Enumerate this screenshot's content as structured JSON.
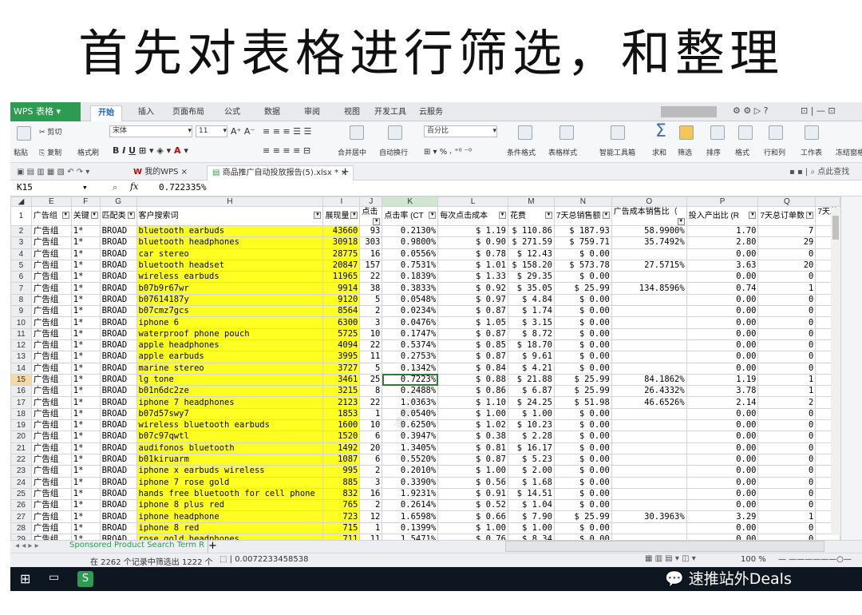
{
  "slide_title": "首先对表格进行筛选，和整理",
  "app": {
    "name": "WPS 表格",
    "menu": [
      "开始",
      "插入",
      "页面布局",
      "公式",
      "数据",
      "审阅",
      "视图",
      "开发工具",
      "云服务"
    ],
    "search_hint": "点此查找"
  },
  "ribbon": {
    "paste": "粘贴",
    "cut": "剪切",
    "copy": "复制",
    "format_painter": "格式刷",
    "font_name": "宋体",
    "font_size": "11",
    "merge_center": "合并居中",
    "wrap": "自动换行",
    "number_format": "百分比",
    "cond_format": "条件格式",
    "table_style": "表格样式",
    "smart_toolbox": "智能工具箱",
    "sum": "求和",
    "filter": "筛选",
    "sort": "排序",
    "format": "格式",
    "rowcol": "行和列",
    "sheet": "工作表",
    "freeze": "冻结窗格"
  },
  "doc_tabs": [
    "我的WPS",
    "商品推广自动投放报告(5).xlsx *"
  ],
  "formula_bar": {
    "cell_ref": "K15",
    "fx": "fx",
    "value": "0.722335%"
  },
  "columns": [
    "E",
    "F",
    "G",
    "H",
    "I",
    "J",
    "K",
    "L",
    "M",
    "N",
    "O",
    "P",
    "Q"
  ],
  "headers": [
    "广告组",
    "关键",
    "匹配类",
    "客户搜索词",
    "展现量",
    "点击",
    "点击率 (CT",
    "每次点击成本",
    "花费",
    "7天总销售额",
    "广告成本销售比（",
    "投入产出比 (R",
    "7天总订单数",
    "7天总"
  ],
  "rows": [
    {
      "n": "2",
      "e": "广告组",
      "f": "1*",
      "g": "BROAD",
      "h": "bluetooth earbuds",
      "i": "43660",
      "j": "93",
      "k": "0.2130%",
      "l": "$ 1.19",
      "m": "$ 110.86",
      "nn": "$ 187.93",
      "o": "58.9900%",
      "p": "1.70",
      "q": "7"
    },
    {
      "n": "3",
      "e": "广告组",
      "f": "1*",
      "g": "BROAD",
      "h": "bluetooth headphones",
      "i": "30918",
      "j": "303",
      "k": "0.9800%",
      "l": "$ 0.90",
      "m": "$ 271.59",
      "nn": "$ 759.71",
      "o": "35.7492%",
      "p": "2.80",
      "q": "29"
    },
    {
      "n": "4",
      "e": "广告组",
      "f": "1*",
      "g": "BROAD",
      "h": "car stereo",
      "i": "28775",
      "j": "16",
      "k": "0.0556%",
      "l": "$ 0.78",
      "m": "$ 12.43",
      "nn": "$ 0.00",
      "o": "",
      "p": "0.00",
      "q": "0"
    },
    {
      "n": "5",
      "e": "广告组",
      "f": "1*",
      "g": "BROAD",
      "h": "bluetooth headset",
      "i": "20847",
      "j": "157",
      "k": "0.7531%",
      "l": "$ 1.01",
      "m": "$ 158.20",
      "nn": "$ 573.78",
      "o": "27.5715%",
      "p": "3.63",
      "q": "20"
    },
    {
      "n": "6",
      "e": "广告组",
      "f": "1*",
      "g": "BROAD",
      "h": "wireless earbuds",
      "i": "11965",
      "j": "22",
      "k": "0.1839%",
      "l": "$ 1.33",
      "m": "$ 29.35",
      "nn": "$ 0.00",
      "o": "",
      "p": "0.00",
      "q": "0"
    },
    {
      "n": "7",
      "e": "广告组",
      "f": "1*",
      "g": "BROAD",
      "h": "b07b9r67wr",
      "i": "9914",
      "j": "38",
      "k": "0.3833%",
      "l": "$ 0.92",
      "m": "$ 35.05",
      "nn": "$ 25.99",
      "o": "134.8596%",
      "p": "0.74",
      "q": "1"
    },
    {
      "n": "8",
      "e": "广告组",
      "f": "1*",
      "g": "BROAD",
      "h": "b07614187y",
      "i": "9120",
      "j": "5",
      "k": "0.0548%",
      "l": "$ 0.97",
      "m": "$ 4.84",
      "nn": "$ 0.00",
      "o": "",
      "p": "0.00",
      "q": "0"
    },
    {
      "n": "9",
      "e": "广告组",
      "f": "1*",
      "g": "BROAD",
      "h": "b07cmz7gcs",
      "i": "8564",
      "j": "2",
      "k": "0.0234%",
      "l": "$ 0.87",
      "m": "$ 1.74",
      "nn": "$ 0.00",
      "o": "",
      "p": "0.00",
      "q": "0"
    },
    {
      "n": "10",
      "e": "广告组",
      "f": "1*",
      "g": "BROAD",
      "h": "iphone 6",
      "i": "6300",
      "j": "3",
      "k": "0.0476%",
      "l": "$ 1.05",
      "m": "$ 3.15",
      "nn": "$ 0.00",
      "o": "",
      "p": "0.00",
      "q": "0"
    },
    {
      "n": "11",
      "e": "广告组",
      "f": "1*",
      "g": "BROAD",
      "h": "waterproof phone pouch",
      "i": "5725",
      "j": "10",
      "k": "0.1747%",
      "l": "$ 0.87",
      "m": "$ 8.72",
      "nn": "$ 0.00",
      "o": "",
      "p": "0.00",
      "q": "0"
    },
    {
      "n": "12",
      "e": "广告组",
      "f": "1*",
      "g": "BROAD",
      "h": "apple headphones",
      "i": "4094",
      "j": "22",
      "k": "0.5374%",
      "l": "$ 0.85",
      "m": "$ 18.70",
      "nn": "$ 0.00",
      "o": "",
      "p": "0.00",
      "q": "0"
    },
    {
      "n": "13",
      "e": "广告组",
      "f": "1*",
      "g": "BROAD",
      "h": "apple earbuds",
      "i": "3995",
      "j": "11",
      "k": "0.2753%",
      "l": "$ 0.87",
      "m": "$ 9.61",
      "nn": "$ 0.00",
      "o": "",
      "p": "0.00",
      "q": "0"
    },
    {
      "n": "14",
      "e": "广告组",
      "f": "1*",
      "g": "BROAD",
      "h": "marine stereo",
      "i": "3727",
      "j": "5",
      "k": "0.1342%",
      "l": "$ 0.84",
      "m": "$ 4.21",
      "nn": "$ 0.00",
      "o": "",
      "p": "0.00",
      "q": "0"
    },
    {
      "n": "15",
      "e": "广告组",
      "f": "1*",
      "g": "BROAD",
      "h": "lg tone",
      "i": "3461",
      "j": "25",
      "k": "0.7223%",
      "l": "$ 0.88",
      "m": "$ 21.88",
      "nn": "$ 25.99",
      "o": "84.1862%",
      "p": "1.19",
      "q": "1"
    },
    {
      "n": "16",
      "e": "广告组",
      "f": "1*",
      "g": "BROAD",
      "h": "b01n6dc2ze",
      "i": "3215",
      "j": "8",
      "k": "0.2488%",
      "l": "$ 0.86",
      "m": "$ 6.87",
      "nn": "$ 25.99",
      "o": "26.4332%",
      "p": "3.78",
      "q": "1"
    },
    {
      "n": "17",
      "e": "广告组",
      "f": "1*",
      "g": "BROAD",
      "h": "iphone 7 headphones",
      "i": "2123",
      "j": "22",
      "k": "1.0363%",
      "l": "$ 1.10",
      "m": "$ 24.25",
      "nn": "$ 51.98",
      "o": "46.6526%",
      "p": "2.14",
      "q": "2"
    },
    {
      "n": "18",
      "e": "广告组",
      "f": "1*",
      "g": "BROAD",
      "h": "b07d57swy7",
      "i": "1853",
      "j": "1",
      "k": "0.0540%",
      "l": "$ 1.00",
      "m": "$ 1.00",
      "nn": "$ 0.00",
      "o": "",
      "p": "0.00",
      "q": "0"
    },
    {
      "n": "19",
      "e": "广告组",
      "f": "1*",
      "g": "BROAD",
      "h": "wireless bluetooth earbuds",
      "i": "1600",
      "j": "10",
      "k": "0.6250%",
      "l": "$ 1.02",
      "m": "$ 10.23",
      "nn": "$ 0.00",
      "o": "",
      "p": "0.00",
      "q": "0"
    },
    {
      "n": "20",
      "e": "广告组",
      "f": "1*",
      "g": "BROAD",
      "h": "b07c97qwtl",
      "i": "1520",
      "j": "6",
      "k": "0.3947%",
      "l": "$ 0.38",
      "m": "$ 2.28",
      "nn": "$ 0.00",
      "o": "",
      "p": "0.00",
      "q": "0"
    },
    {
      "n": "21",
      "e": "广告组",
      "f": "1*",
      "g": "BROAD",
      "h": "audifonos bluetooth",
      "i": "1492",
      "j": "20",
      "k": "1.3405%",
      "l": "$ 0.81",
      "m": "$ 16.17",
      "nn": "$ 0.00",
      "o": "",
      "p": "0.00",
      "q": "0"
    },
    {
      "n": "22",
      "e": "广告组",
      "f": "1*",
      "g": "BROAD",
      "h": "b01kiruarm",
      "i": "1087",
      "j": "6",
      "k": "0.5520%",
      "l": "$ 0.87",
      "m": "$ 5.23",
      "nn": "$ 0.00",
      "o": "",
      "p": "0.00",
      "q": "0"
    },
    {
      "n": "23",
      "e": "广告组",
      "f": "1*",
      "g": "BROAD",
      "h": "iphone x earbuds wireless",
      "i": "995",
      "j": "2",
      "k": "0.2010%",
      "l": "$ 1.00",
      "m": "$ 2.00",
      "nn": "$ 0.00",
      "o": "",
      "p": "0.00",
      "q": "0"
    },
    {
      "n": "24",
      "e": "广告组",
      "f": "1*",
      "g": "BROAD",
      "h": "iphone 7 rose gold",
      "i": "885",
      "j": "3",
      "k": "0.3390%",
      "l": "$ 0.56",
      "m": "$ 1.68",
      "nn": "$ 0.00",
      "o": "",
      "p": "0.00",
      "q": "0"
    },
    {
      "n": "25",
      "e": "广告组",
      "f": "1*",
      "g": "BROAD",
      "h": "hands free bluetooth for cell phone",
      "i": "832",
      "j": "16",
      "k": "1.9231%",
      "l": "$ 0.91",
      "m": "$ 14.51",
      "nn": "$ 0.00",
      "o": "",
      "p": "0.00",
      "q": "0"
    },
    {
      "n": "26",
      "e": "广告组",
      "f": "1*",
      "g": "BROAD",
      "h": "iphone 8 plus red",
      "i": "765",
      "j": "2",
      "k": "0.2614%",
      "l": "$ 0.52",
      "m": "$ 1.04",
      "nn": "$ 0.00",
      "o": "",
      "p": "0.00",
      "q": "0"
    },
    {
      "n": "27",
      "e": "广告组",
      "f": "1*",
      "g": "BROAD",
      "h": "iphone headphone",
      "i": "723",
      "j": "12",
      "k": "1.6598%",
      "l": "$ 0.66",
      "m": "$ 7.90",
      "nn": "$ 25.99",
      "o": "30.3963%",
      "p": "3.29",
      "q": "1"
    },
    {
      "n": "28",
      "e": "广告组",
      "f": "1*",
      "g": "BROAD",
      "h": "iphone 8 red",
      "i": "715",
      "j": "1",
      "k": "0.1399%",
      "l": "$ 1.00",
      "m": "$ 1.00",
      "nn": "$ 0.00",
      "o": "",
      "p": "0.00",
      "q": "0"
    },
    {
      "n": "29",
      "e": "广告组",
      "f": "1*",
      "g": "BROAD",
      "h": "rose gold headphones",
      "i": "711",
      "j": "11",
      "k": "1.5471%",
      "l": "$ 0.76",
      "m": "$ 8.34",
      "nn": "$ 0.00",
      "o": "",
      "p": "0.00",
      "q": "0"
    }
  ],
  "active_row": "15",
  "sheet_tab": "Sponsored Product Search Term R",
  "status": {
    "text": "在 2262 个记录中筛选出 1222 个",
    "value": "0.0072233458538",
    "zoom": "100 %"
  },
  "watermark": "速推站外",
  "taskbar_brand": "速推站外Deals",
  "colors": {
    "highlight": "#ffff22",
    "wps_green": "#2e9b53",
    "active_cell": "#2f7d32"
  }
}
